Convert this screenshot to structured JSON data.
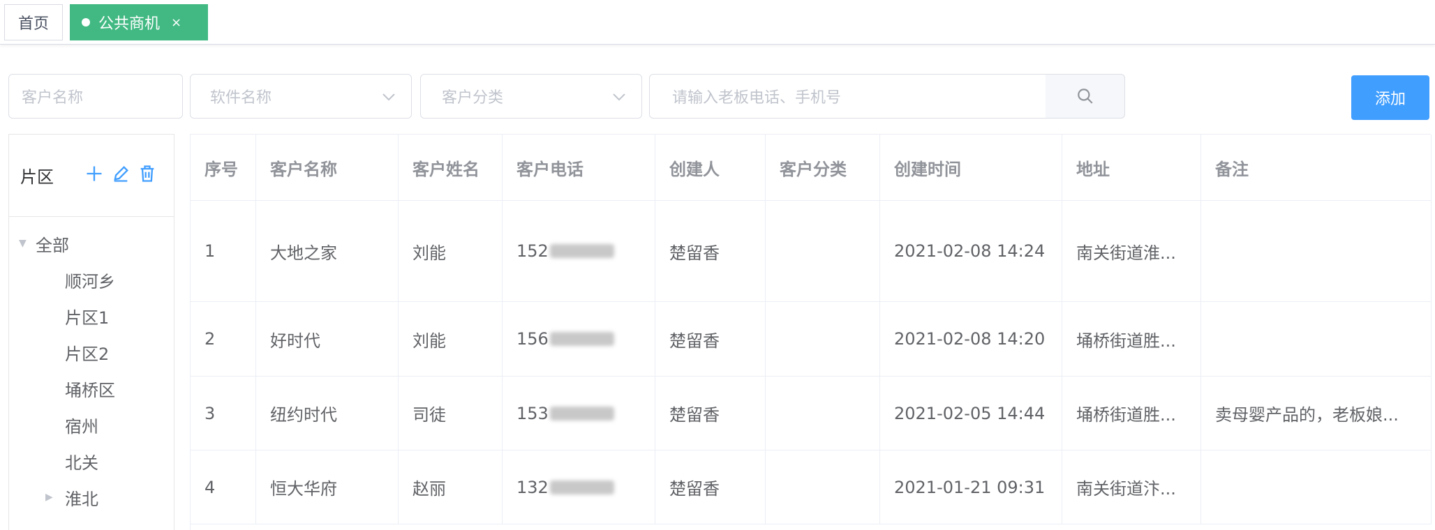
{
  "tabs": [
    {
      "label": "首页",
      "active": false
    },
    {
      "label": "公共商机",
      "active": true,
      "close": "×"
    }
  ],
  "filters": {
    "customer_name_placeholder": "客户名称",
    "software_name_placeholder": "软件名称",
    "customer_category_placeholder": "客户分类",
    "phone_search_placeholder": "请输入老板电话、手机号",
    "add_label": "添加"
  },
  "sidebar": {
    "title": "片区",
    "tree": [
      {
        "label": "全部",
        "level": 0,
        "expanded": true
      },
      {
        "label": "顺河乡",
        "level": 1
      },
      {
        "label": "片区1",
        "level": 1
      },
      {
        "label": "片区2",
        "level": 1
      },
      {
        "label": "埇桥区",
        "level": 1
      },
      {
        "label": "宿州",
        "level": 1
      },
      {
        "label": "北关",
        "level": 1
      },
      {
        "label": "淮北",
        "level": 1,
        "expanded": false
      }
    ]
  },
  "table": {
    "headers": [
      "序号",
      "客户名称",
      "客户姓名",
      "客户电话",
      "创建人",
      "客户分类",
      "创建时间",
      "地址",
      "备注"
    ],
    "rows": [
      {
        "index": "1",
        "customer_name": "大地之家",
        "contact": "刘能",
        "phone_prefix": "152",
        "creator": "楚留香",
        "category": "",
        "created": "2021-02-08 14:24",
        "address": "南关街道淮...",
        "remark": ""
      },
      {
        "index": "2",
        "customer_name": "好时代",
        "contact": "刘能",
        "phone_prefix": "156",
        "creator": "楚留香",
        "category": "",
        "created": "2021-02-08 14:20",
        "address": "埇桥街道胜...",
        "remark": ""
      },
      {
        "index": "3",
        "customer_name": "纽约时代",
        "contact": "司徒",
        "phone_prefix": "153",
        "creator": "楚留香",
        "category": "",
        "created": "2021-02-05 14:44",
        "address": "埇桥街道胜...",
        "remark": "卖母婴产品的，老板娘..."
      },
      {
        "index": "4",
        "customer_name": "恒大华府",
        "contact": "赵丽",
        "phone_prefix": "132",
        "creator": "楚留香",
        "category": "",
        "created": "2021-01-21 09:31",
        "address": "南关街道汴...",
        "remark": ""
      }
    ]
  },
  "colors": {
    "accent_green": "#42b983",
    "primary_blue": "#409eff"
  }
}
